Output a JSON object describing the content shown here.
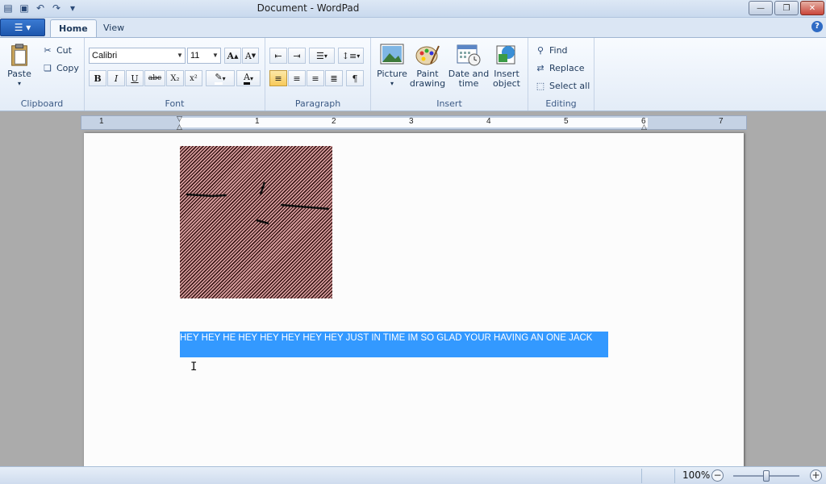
{
  "window": {
    "title": "Document - WordPad"
  },
  "tabs": [
    {
      "label": "Home"
    },
    {
      "label": "View"
    }
  ],
  "clipboard": {
    "paste_label": "Paste",
    "cut_label": "Cut",
    "copy_label": "Copy",
    "group_label": "Clipboard"
  },
  "font": {
    "family": "Calibri",
    "size": "11",
    "group_label": "Font",
    "bold": "B",
    "italic": "I",
    "underline": "U",
    "strike": "abc",
    "subscript": "X₂",
    "superscript": "x²",
    "color_letter": "A"
  },
  "paragraph": {
    "group_label": "Paragraph"
  },
  "insert": {
    "picture_label": "Picture",
    "paint_label_1": "Paint",
    "paint_label_2": "drawing",
    "datetime_label_1": "Date and",
    "datetime_label_2": "time",
    "object_label_1": "Insert",
    "object_label_2": "object",
    "group_label": "Insert"
  },
  "editing": {
    "find_label": "Find",
    "replace_label": "Replace",
    "select_all_label": "Select all",
    "group_label": "Editing"
  },
  "ruler": {
    "numbers": [
      "1",
      "1",
      "2",
      "3",
      "4",
      "5",
      "6",
      "7"
    ]
  },
  "document": {
    "selected_text": "HEY HEY HE HEY HEY HEY HEY HEY JUST IN TIME IM SO GLAD YOUR HAVING AN ONE JACK"
  },
  "status": {
    "zoom": "100%"
  },
  "colors": {
    "selection": "#3399ff",
    "accent": "#1d56ad"
  }
}
